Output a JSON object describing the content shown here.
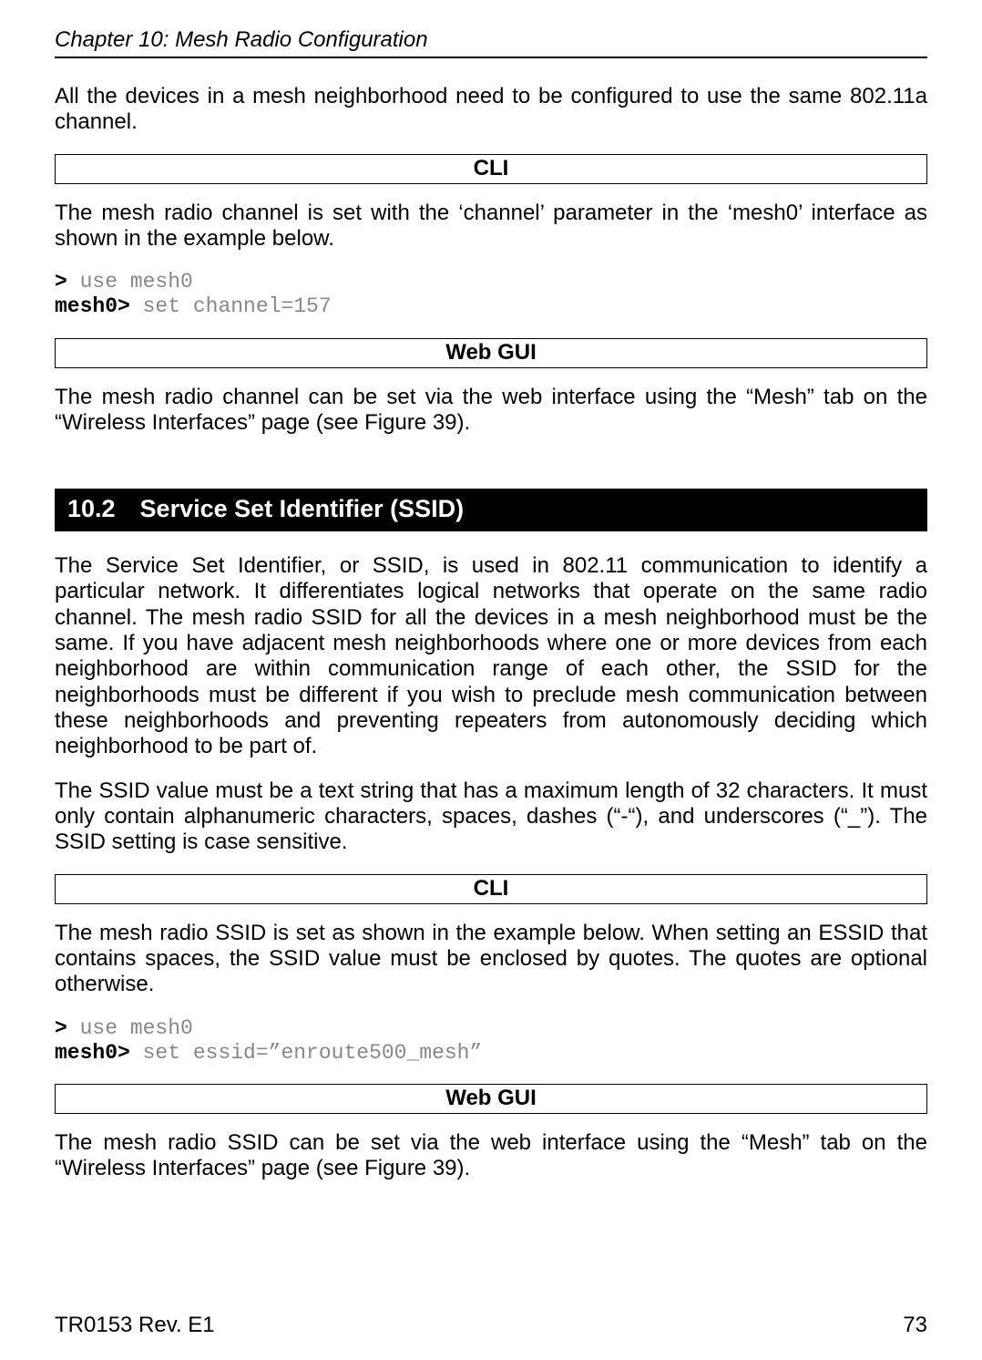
{
  "header": "Chapter 10: Mesh Radio Configuration",
  "p1": "All the devices in a mesh neighborhood need to be configured to use the same 802.11a channel.",
  "box_cli": "CLI",
  "p2": "The mesh radio channel is set with the ‘channel’ parameter in the ‘mesh0’ interface as shown in the example below.",
  "cli1_prompt1": ">",
  "cli1_cmd1": " use mesh0",
  "cli1_prompt2": "mesh0>",
  "cli1_cmd2": " set channel=157",
  "box_webgui": "Web GUI",
  "p3": "The mesh radio channel can be set via the web interface using the “Mesh” tab on the “Wireless Interfaces” page (see Figure 39).",
  "section_10_2": "10.2 Service Set Identifier (SSID)",
  "p4": "The Service Set Identifier, or SSID, is used in 802.11 communication to identify a particular network. It differentiates logical networks that operate on the same radio channel. The mesh radio SSID for all the devices in a mesh neighborhood must be the same. If you have adjacent mesh neighborhoods where one or more devices from each neighborhood are within communication range of each other, the SSID for the neighborhoods must be different if you wish to preclude mesh communication between these neighborhoods and preventing repeaters from autonomously deciding which neighborhood to be part of.",
  "p5": "The SSID value must be a text string that has a maximum length of 32 characters. It must only contain alphanumeric characters, spaces, dashes (“-“), and underscores (“_”). The SSID setting is case sensitive.",
  "p6": "The mesh radio SSID is set as shown in the example below. When setting an ESSID that contains spaces, the SSID value must be enclosed by quotes. The quotes are optional otherwise.",
  "cli2_prompt1": ">",
  "cli2_cmd1": " use mesh0",
  "cli2_prompt2": "mesh0>",
  "cli2_cmd2": " set essid=”enroute500_mesh”",
  "p7": "The mesh radio SSID can be set via the web interface using the “Mesh” tab on the “Wireless Interfaces” page (see Figure 39).",
  "footer_left": "TR0153 Rev. E1",
  "footer_right": "73"
}
